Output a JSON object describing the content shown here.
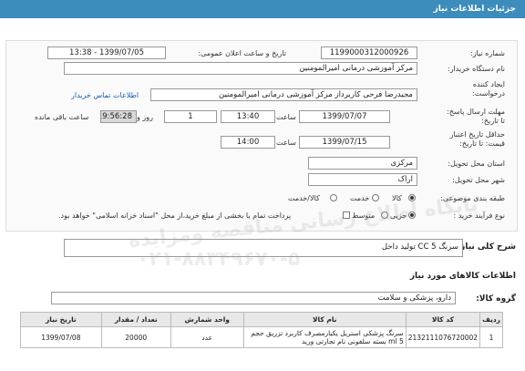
{
  "header": {
    "title": "جزئیات اطلاعات نیاز"
  },
  "form": {
    "need_number_label": "شماره نیاز:",
    "need_number": "1199000312000926",
    "announce_label": "تاریخ و ساعت اعلان عمومی:",
    "announce_value": "1399/07/05 - 13:38",
    "buyer_label": "نام دستگاه خریدار:",
    "buyer_value": "مرکز آموزشی درمانی امیرالمومنین",
    "creator_label": "ایجاد کننده درخواست:",
    "creator_value": "مجیدرضا فرحی کاربرداز مرکز آموزشی درمانی امیرالمومنین",
    "contact_link": "اطلاعات تماس خریدار",
    "deadline_label": "مهلت ارسال پاسخ: تا تاریخ:",
    "deadline_date": "1399/07/07",
    "time_label": "ساعت",
    "deadline_time": "13:40",
    "days_value": "1",
    "days_label": "روز و",
    "remaining_time": "19:56:28",
    "remaining_label": "ساعت باقی مانده",
    "validity_label": "حداقل تاریخ اعتبار قیمت: تا تاریخ:",
    "validity_date": "1399/07/15",
    "validity_time": "14:00",
    "province_label": "استان محل تحویل:",
    "province_value": "مرکزی",
    "city_label": "شهر محل تحویل:",
    "city_value": "اراک",
    "category_label": "طبقه بندی موضوعی:",
    "category_options": [
      "کالا",
      "خدمت",
      "کالا/خدمت"
    ],
    "category_selected": "کالا",
    "process_label": "نوع فرآیند خرید :",
    "process_options": [
      "جزیی",
      "متوسط"
    ],
    "process_selected": "جزیی",
    "payment_note": "پرداخت تمام یا بخشی از مبلغ خرید،از محل \"اسناد خزانه اسلامی\" خواهد بود."
  },
  "summary": {
    "label": "شرح کلی نیاز:",
    "value": "سرنگ CC 5 تولید داخل"
  },
  "goods": {
    "section_title": "اطلاعات کالاهای مورد نیاز",
    "group_label": "گروه کالا:",
    "group_value": "دارو، پزشکی و سلامت",
    "columns": [
      "ردیف",
      "کد کالا",
      "نام کالا",
      "واحد شمارش",
      "تعداد / مقدار",
      "تاریخ نیاز"
    ],
    "rows": [
      {
        "index": "1",
        "code": "2132111076720002",
        "name": "سرنگ پزشکی استریل یکبارمصرف کاربرد تزریق حجم 5 ml بسته سلفونی نام تجارتی ورید",
        "unit": "عدد",
        "qty": "20000",
        "date": "1399/07/08"
      }
    ]
  },
  "watermark": {
    "line1": "پایگاه اطلاع رسانی مناقصه ومزایده",
    "line2": "۰۲۱-۸۸۳۴۹۶۷۰-۵"
  }
}
